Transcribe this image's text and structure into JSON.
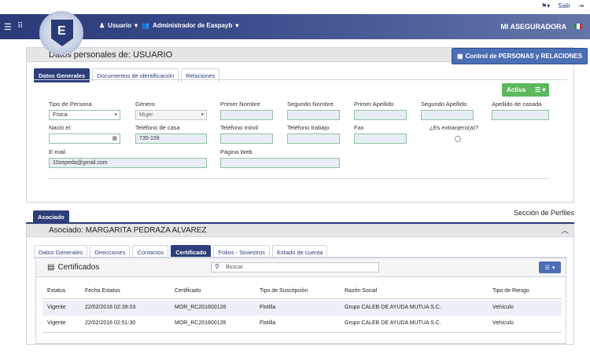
{
  "topbar": {
    "salir": "Salir"
  },
  "navbar": {
    "logo_letter": "E",
    "usuario": "Usuario",
    "admin": "Administrador de Easpayb",
    "brand": "MI ASEGURADORA"
  },
  "personal": {
    "title": "Datos personales de: USUARIO",
    "relaciones_btn": "Control de PERSONAS y RELACIONES",
    "tabs": [
      "Datos Generales",
      "Documentos de identificación",
      "Relaciones"
    ],
    "status": "Activa",
    "labels": {
      "tipo_persona": "Tipo de Persona",
      "genero": "Género",
      "primer_nombre": "Primer Nombre",
      "segundo_nombre": "Segundo Nombre",
      "primer_apellido": "Primer Apellido",
      "segundo_apellido": "Segundo Apellido",
      "apellido_casada": "Apellido de casada",
      "nacio": "Nació el:",
      "tel_casa": "Teléfono de casa",
      "tel_movil": "Teléfono móvil",
      "tel_trabajo": "Teléfono trabajo",
      "fax": "Fax",
      "extranjero": "¿Es extranjero(a)?",
      "email": "E-mail",
      "web": "Página Web"
    },
    "values": {
      "tipo_persona": "Física",
      "genero": "Mujer",
      "tel_casa": "735-159",
      "email": "10zepeda@gmail.com"
    }
  },
  "asociado": {
    "tab": "Asociado",
    "perfiles": "Sección de Perfiles",
    "title": "Asociado: MARGARITA PEDRAZA ALVAREZ",
    "tabs": [
      "Datos Generales",
      "Direcciones",
      "Contactos",
      "Certificado",
      "Folios - Siniestros",
      "Estado de cuenta"
    ],
    "cert_title": "Certificados",
    "search_placeholder": "Buscar",
    "columns": [
      "Estatus",
      "Fecha Estatus",
      "Certificado",
      "Tipo de Suscripción",
      "Razón Social",
      "Tipo de Riesgo"
    ],
    "rows": [
      [
        "Vigente",
        "22/02/2016 02:39:03",
        "MOR_RC201600126",
        "Flotilla",
        "Grupo CALEB DE AYUDA MUTUA S.C.",
        "Vehículo"
      ],
      [
        "Vigente",
        "22/02/2016 02:51:30",
        "MOR_RC201600135",
        "Flotilla",
        "Grupo CALEB DE AYUDA MUTUA S.C.",
        "Vehículo"
      ]
    ]
  }
}
